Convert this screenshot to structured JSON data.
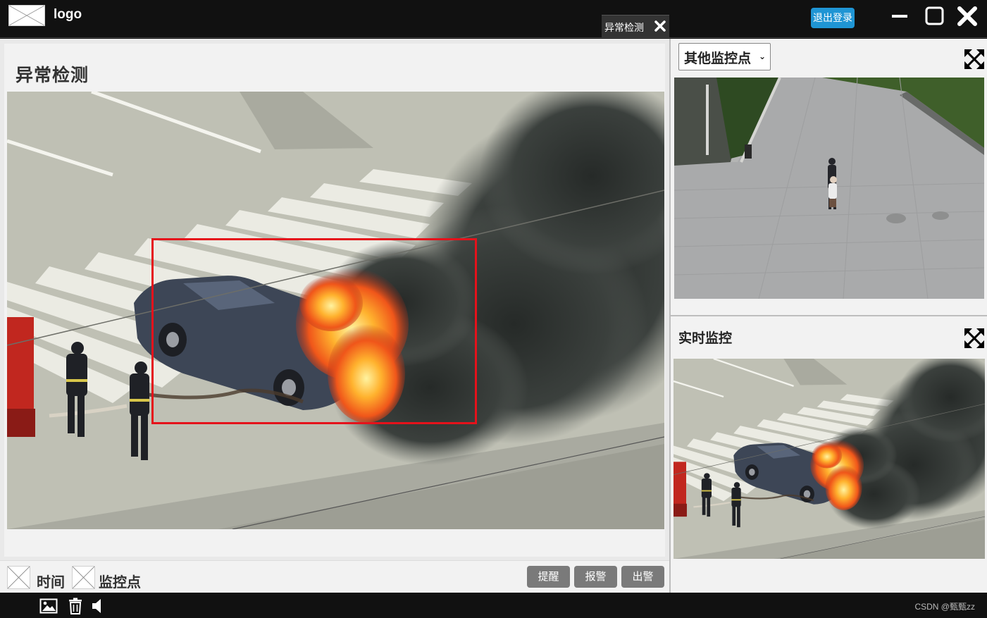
{
  "header": {
    "logo_text": "logo",
    "tab_label": "异常检测",
    "logout_label": "退出登录"
  },
  "main": {
    "title": "异常检测",
    "time_label": "时间",
    "monitor_point_label": "监控点",
    "buttons": {
      "remind": "提醒",
      "alarm": "报警",
      "dispatch": "出警"
    },
    "alert_color": "#e5121b"
  },
  "right": {
    "selector_value": "其他监控点",
    "realtime_title": "实时监控"
  },
  "footer": {
    "credit": "CSDN @甄甄zz",
    "icons": [
      "image-icon",
      "trash-icon",
      "speaker-icon"
    ]
  },
  "colors": {
    "topbar": "#111111",
    "logout_button": "#1f95d4",
    "action_button": "#7a7a7a"
  }
}
